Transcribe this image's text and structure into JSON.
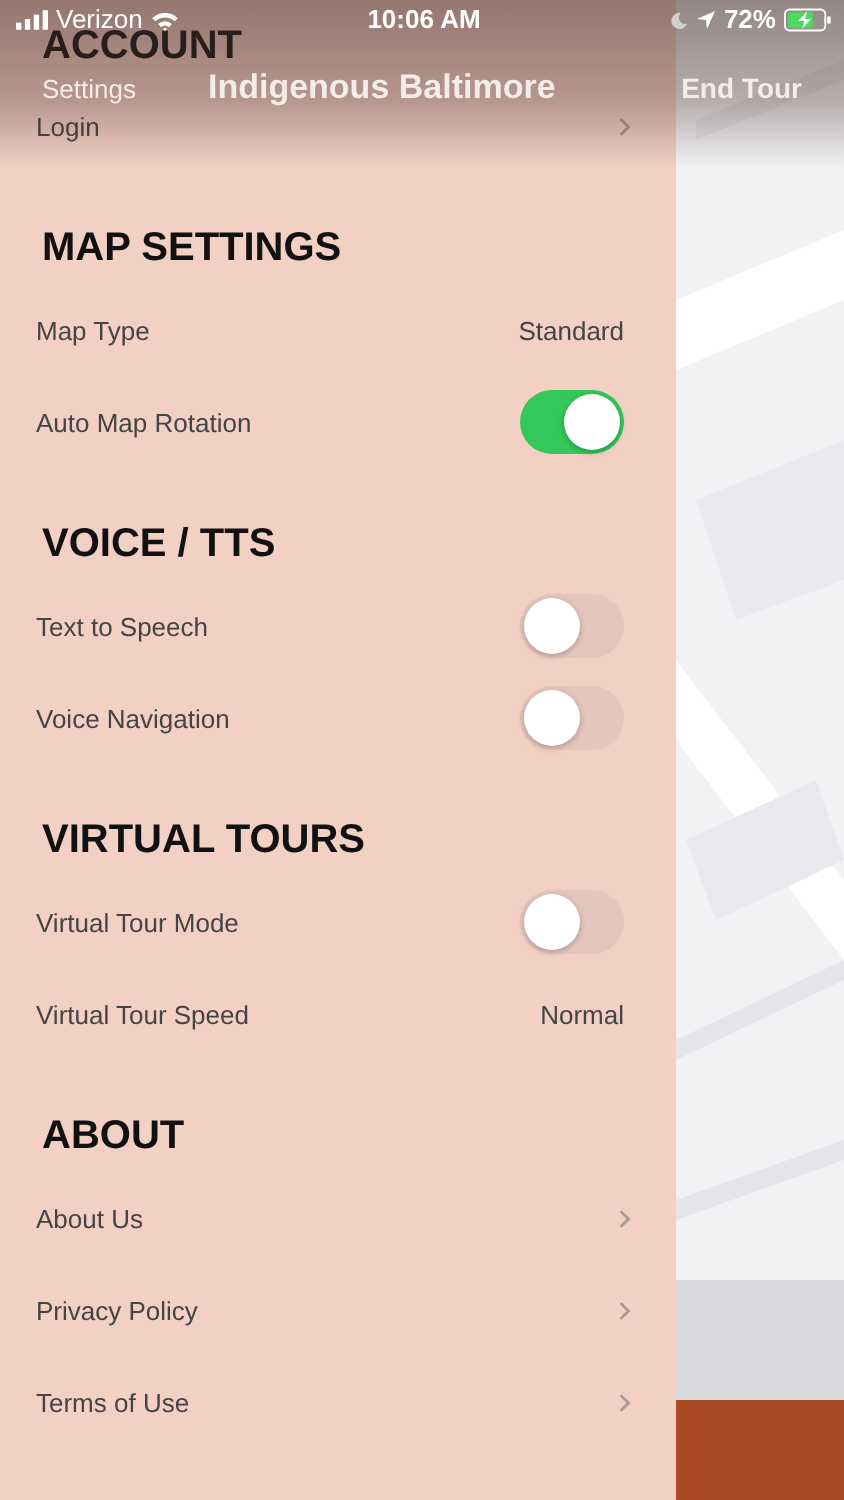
{
  "status_bar": {
    "carrier": "Verizon",
    "time": "10:06 AM",
    "battery": "72%"
  },
  "nav_bar": {
    "back": "Settings",
    "title": "Indigenous Baltimore",
    "action": "End Tour"
  },
  "sections": [
    {
      "title": "ACCOUNT",
      "items": [
        {
          "kind": "link",
          "label": "Login"
        }
      ]
    },
    {
      "title": "MAP SETTINGS",
      "items": [
        {
          "kind": "value",
          "label": "Map Type",
          "value": "Standard"
        },
        {
          "kind": "toggle",
          "label": "Auto Map Rotation",
          "on": true
        }
      ]
    },
    {
      "title": "VOICE / TTS",
      "items": [
        {
          "kind": "toggle",
          "label": "Text to Speech",
          "on": false
        },
        {
          "kind": "toggle",
          "label": "Voice Navigation",
          "on": false
        }
      ]
    },
    {
      "title": "VIRTUAL TOURS",
      "items": [
        {
          "kind": "toggle",
          "label": "Virtual Tour Mode",
          "on": false
        },
        {
          "kind": "value",
          "label": "Virtual Tour Speed",
          "value": "Normal"
        }
      ]
    },
    {
      "title": "ABOUT",
      "items": [
        {
          "kind": "link",
          "label": "About Us"
        },
        {
          "kind": "link",
          "label": "Privacy Policy"
        },
        {
          "kind": "link",
          "label": "Terms of Use"
        }
      ]
    }
  ]
}
